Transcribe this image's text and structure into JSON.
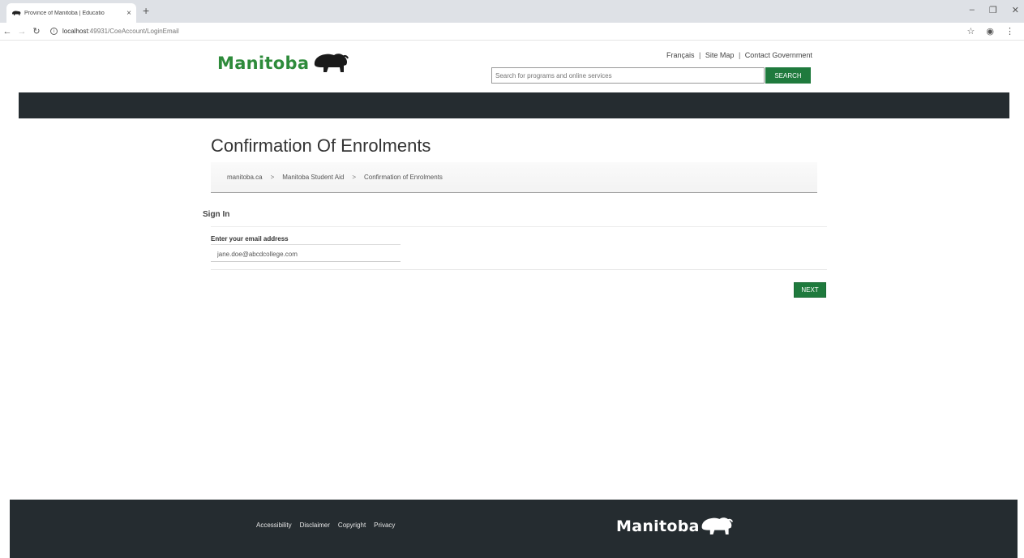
{
  "browser": {
    "tab_title": "Province of Manitoba | Educatio",
    "tab_close": "×",
    "new_tab": "+",
    "url_host": "localhost",
    "url_rest": ":49931/CoeAccount/LoginEmail",
    "icons": [
      "back-arrow-icon",
      "forward-arrow-icon",
      "reload-icon",
      "info-icon",
      "star-icon",
      "account-icon",
      "menu-icon"
    ]
  },
  "header": {
    "logo_text": "Manitoba",
    "utility_links": [
      "Français",
      "Site Map",
      "Contact Government"
    ],
    "search_placeholder": "Search for programs and online services",
    "search_button": "SEARCH"
  },
  "main": {
    "page_title": "Confirmation Of Enrolments",
    "breadcrumb": [
      "manitoba.ca",
      "Manitoba Student Aid",
      "Confirmation of Enrolments"
    ],
    "breadcrumb_separator": ">",
    "section_heading": "Sign In",
    "email_label": "Enter your email address",
    "email_value": "jane.doe@abcdcollege.com",
    "next_button": "NEXT"
  },
  "footer": {
    "links": [
      "Accessibility",
      "Disclaimer",
      "Copyright",
      "Privacy"
    ],
    "logo_text": "Manitoba"
  },
  "colors": {
    "brand_green": "#1f7a3d",
    "logo_green": "#2e8b3b",
    "dark_band": "#252c30"
  }
}
